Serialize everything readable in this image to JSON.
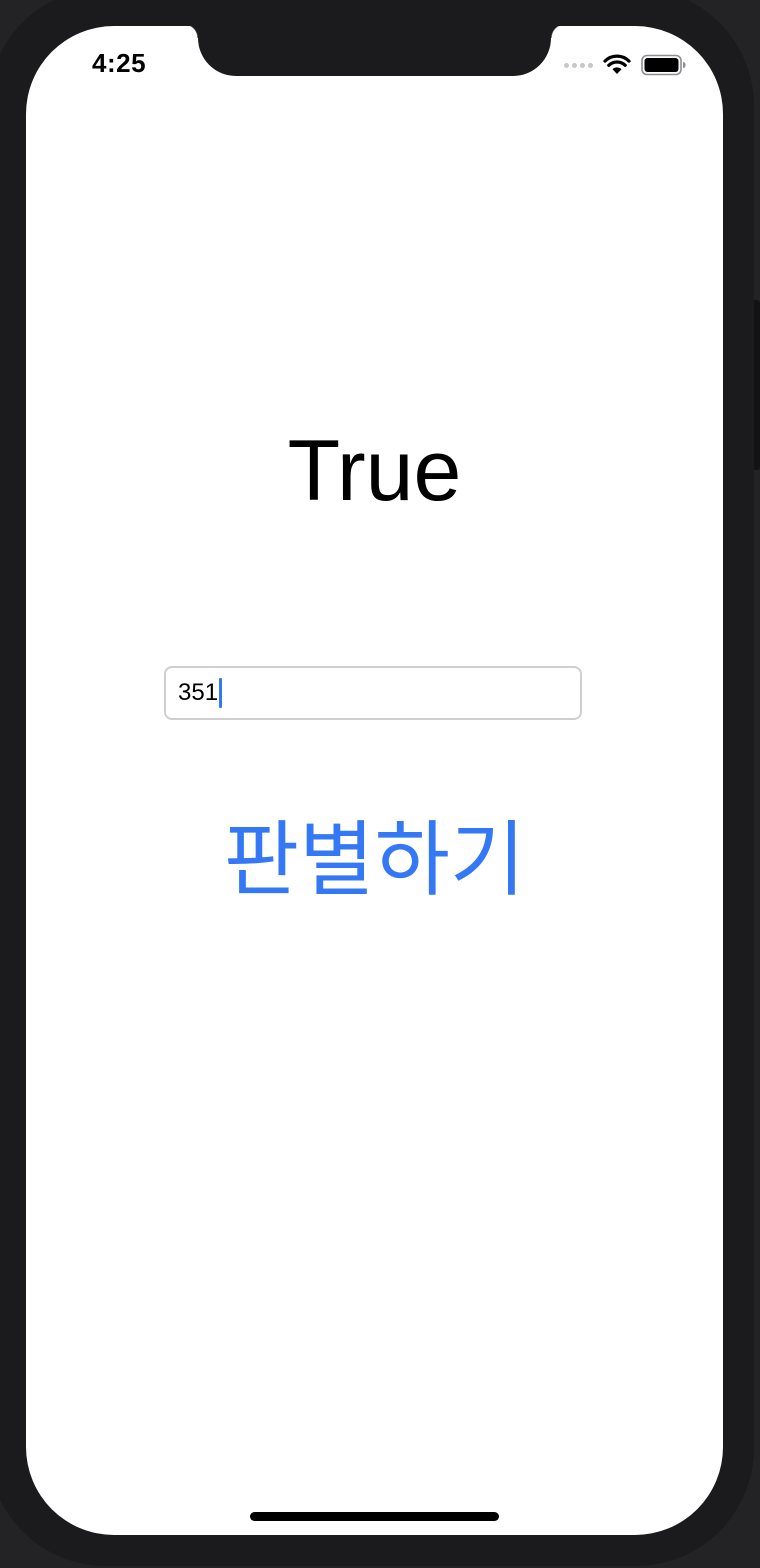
{
  "status_bar": {
    "time": "4:25",
    "icons": [
      "cellular-signal-icon",
      "wifi-icon",
      "battery-icon"
    ]
  },
  "result": {
    "text": "True"
  },
  "input": {
    "value": "351",
    "placeholder": ""
  },
  "button": {
    "label": "판별하기",
    "color": "#3478F6"
  },
  "colors": {
    "accent": "#3478F6",
    "frame": "#1B1B1D",
    "screen": "#FFFFFF"
  }
}
